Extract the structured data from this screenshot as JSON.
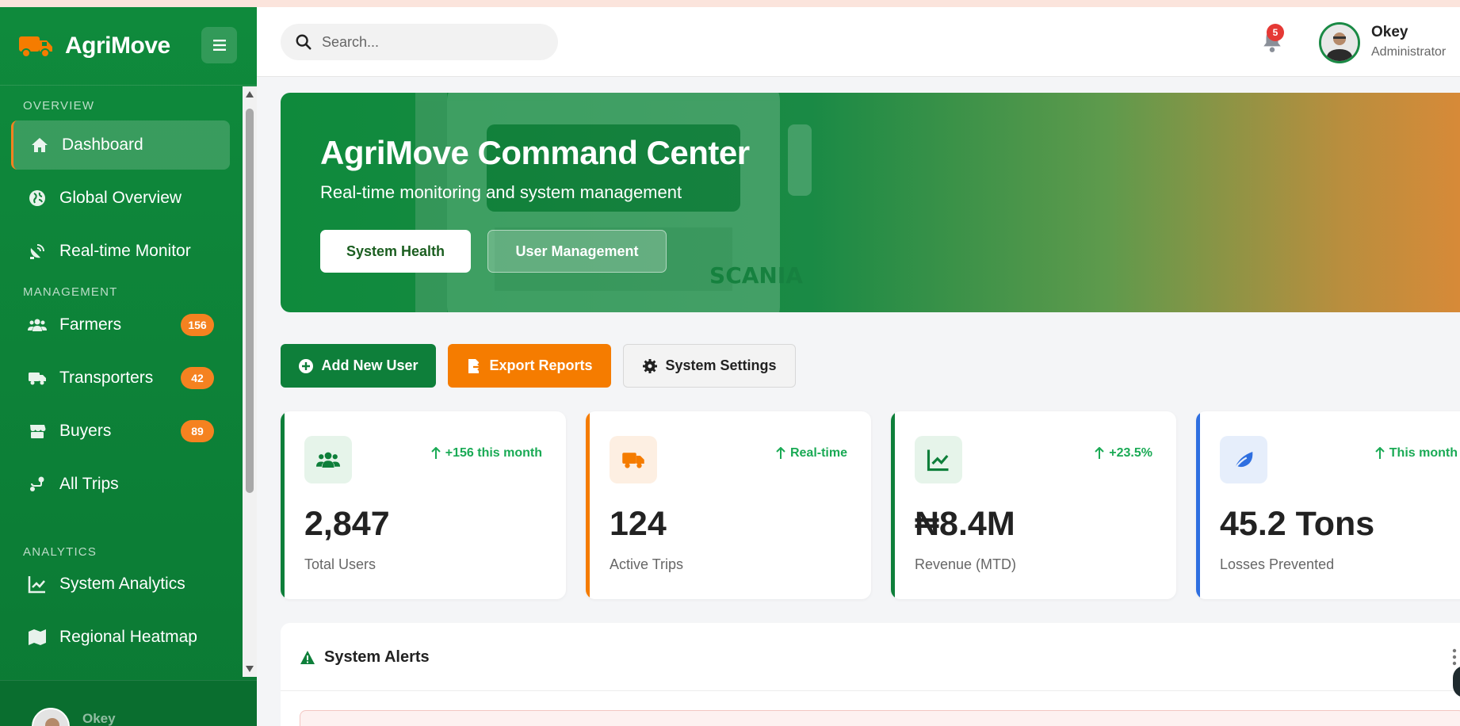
{
  "app": {
    "name": "AgriMove"
  },
  "sidebar": {
    "sections": [
      {
        "label": "OVERVIEW"
      },
      {
        "label": "MANAGEMENT"
      },
      {
        "label": "ANALYTICS"
      }
    ],
    "items": [
      {
        "label": "Dashboard",
        "icon": "home-icon",
        "active": true
      },
      {
        "label": "Global Overview",
        "icon": "globe-icon"
      },
      {
        "label": "Real-time Monitor",
        "icon": "satellite-dish-icon"
      },
      {
        "label": "Farmers",
        "icon": "users-icon",
        "badge": "156"
      },
      {
        "label": "Transporters",
        "icon": "truck-icon",
        "badge": "42"
      },
      {
        "label": "Buyers",
        "icon": "store-icon",
        "badge": "89"
      },
      {
        "label": "All Trips",
        "icon": "route-icon"
      },
      {
        "label": "System Analytics",
        "icon": "chart-line-icon"
      },
      {
        "label": "Regional Heatmap",
        "icon": "map-icon"
      }
    ],
    "footer": {
      "user_name": "Okey"
    }
  },
  "header": {
    "search_placeholder": "Search...",
    "notification_count": "5",
    "user": {
      "name": "Okey",
      "role": "Administrator"
    }
  },
  "hero": {
    "title": "AgriMove Command Center",
    "subtitle": "Real-time monitoring and system management",
    "primary_button": "System Health",
    "secondary_button": "User Management",
    "background_text": "SCANIA"
  },
  "actions": {
    "add_user": "Add New User",
    "export_reports": "Export Reports",
    "system_settings": "System Settings"
  },
  "stats": [
    {
      "value": "2,847",
      "label": "Total Users",
      "trend": "+156 this month",
      "accent": "#0e7f3a",
      "icon": "users-icon"
    },
    {
      "value": "124",
      "label": "Active Trips",
      "trend": "Real-time",
      "accent": "#f57c00",
      "icon": "truck-icon"
    },
    {
      "value": "₦8.4M",
      "label": "Revenue (MTD)",
      "trend": "+23.5%",
      "accent": "#0e7f3a",
      "icon": "chart-line-icon"
    },
    {
      "value": "45.2 Tons",
      "label": "Losses Prevented",
      "trend": "This month",
      "accent": "#2f6fe0",
      "icon": "leaf-icon"
    }
  ],
  "alerts": {
    "title": "System Alerts"
  },
  "colors": {
    "brand_green": "#0e7f3a",
    "accent_orange": "#f57c00",
    "alert_red": "#e53935",
    "trend_green": "#1aaa55"
  }
}
